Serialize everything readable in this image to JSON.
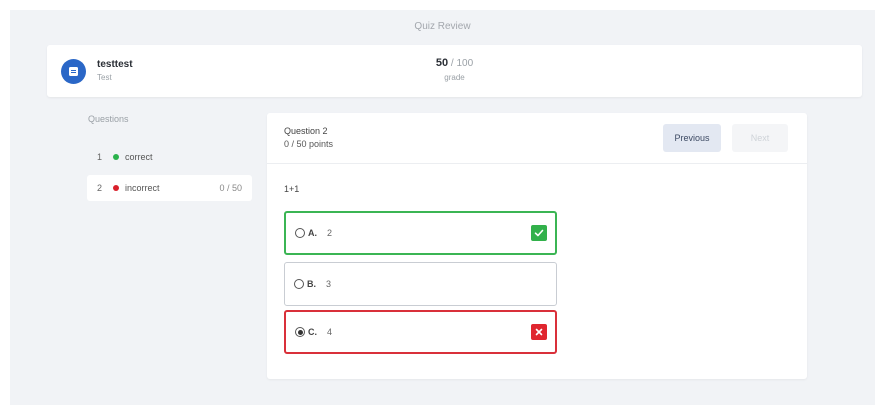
{
  "page": {
    "title": "Quiz Review"
  },
  "header": {
    "user_name": "testtest",
    "user_sub": "Test",
    "score_value": "50",
    "score_total": "/ 100",
    "score_label": "grade",
    "avatar_icon": "document-icon",
    "avatar_color": "#2a67c7"
  },
  "sidebar": {
    "title": "Questions",
    "items": [
      {
        "num": "1",
        "status": "correct",
        "score": "",
        "color": "#2bb24c"
      },
      {
        "num": "2",
        "status": "incorrect",
        "score": "0 / 50",
        "color": "#d9202b"
      }
    ]
  },
  "question": {
    "title": "Question 2",
    "points": "0 / 50 points",
    "prev_label": "Previous",
    "next_label": "Next",
    "text": "1+1",
    "options": [
      {
        "letter": "A.",
        "text": "2",
        "state": "correct",
        "selected": false,
        "icon": "check-icon"
      },
      {
        "letter": "B.",
        "text": "3",
        "state": "neutral",
        "selected": false,
        "icon": ""
      },
      {
        "letter": "C.",
        "text": "4",
        "state": "wrong",
        "selected": true,
        "icon": "x-icon"
      }
    ]
  },
  "colors": {
    "correct": "#3bb554",
    "wrong": "#d9303a",
    "accent": "#2a67c7"
  }
}
